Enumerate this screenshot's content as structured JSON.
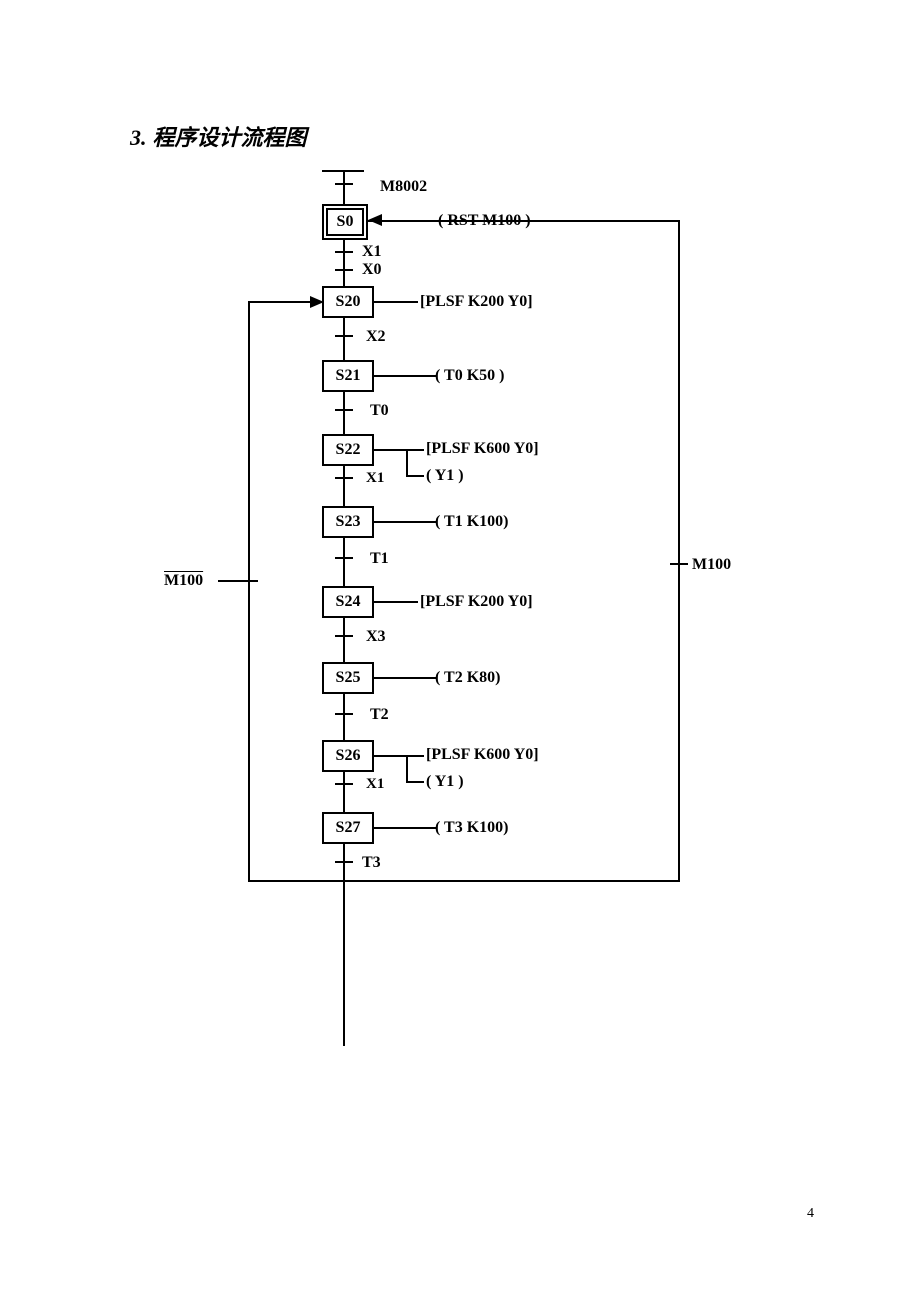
{
  "title_num": "3.",
  "title_text": "程序设计流程图",
  "top": "M8002",
  "s0": "S0",
  "s0_out": "( RST M100 )",
  "x1": "X1",
  "x0": "X0",
  "s20": "S20",
  "s20_out": "[PLSF  K200  Y0]",
  "x2": "X2",
  "s21": "S21",
  "s21_out": "( T0  K50 )",
  "t0": "T0",
  "s22": "S22",
  "s22_out": "[PLSF  K600  Y0]",
  "s22_out2": "( Y1 )",
  "x1b": "X1",
  "s23": "S23",
  "s23_out": "( T1  K100)",
  "t1": "T1",
  "s24": "S24",
  "s24_out": "[PLSF  K200  Y0]",
  "x3": "X3",
  "s25": "S25",
  "s25_out": "( T2  K80)",
  "t2": "T2",
  "s26": "S26",
  "s26_out": "[PLSF  K600  Y0]",
  "s26_out2": "( Y1 )",
  "x1c": "X1",
  "s27": "S27",
  "s27_out": "( T3  K100)",
  "t3": "T3",
  "left": "M100",
  "right": "M100",
  "page": "4"
}
